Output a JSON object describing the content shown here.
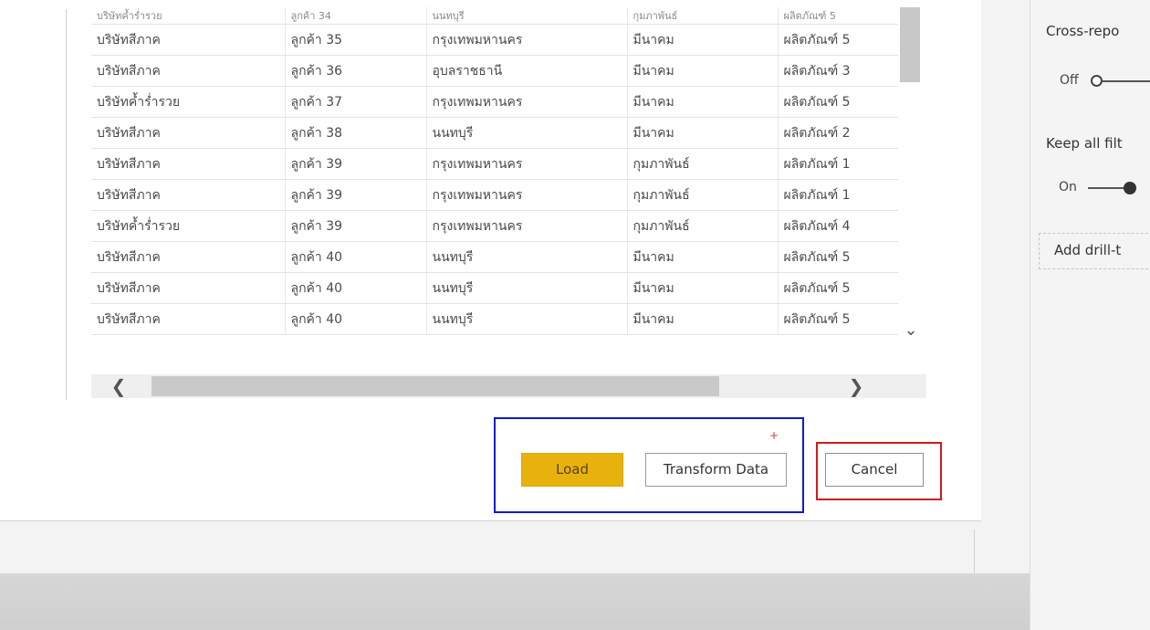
{
  "table": {
    "cut_row": [
      "บริษัทค้ำร่ำรวย",
      "ลูกค้า 34",
      "นนทบุรี",
      "กุมภาพันธ์",
      "ผลิตภัณฑ์ 5"
    ],
    "rows": [
      [
        "บริษัทสีภาค",
        "ลูกค้า 35",
        "กรุงเทพมหานคร",
        "มีนาคม",
        "ผลิตภัณฑ์ 5"
      ],
      [
        "บริษัทสีภาค",
        "ลูกค้า 36",
        "อุบลราชธานี",
        "มีนาคม",
        "ผลิตภัณฑ์ 3"
      ],
      [
        "บริษัทค้ำร่ำรวย",
        "ลูกค้า 37",
        "กรุงเทพมหานคร",
        "มีนาคม",
        "ผลิตภัณฑ์ 5"
      ],
      [
        "บริษัทสีภาค",
        "ลูกค้า 38",
        "นนทบุรี",
        "มีนาคม",
        "ผลิตภัณฑ์ 2"
      ],
      [
        "บริษัทสีภาค",
        "ลูกค้า 39",
        "กรุงเทพมหานคร",
        "กุมภาพันธ์",
        "ผลิตภัณฑ์ 1"
      ],
      [
        "บริษัทสีภาค",
        "ลูกค้า 39",
        "กรุงเทพมหานคร",
        "กุมภาพันธ์",
        "ผลิตภัณฑ์ 1"
      ],
      [
        "บริษัทค้ำร่ำรวย",
        "ลูกค้า 39",
        "กรุงเทพมหานคร",
        "กุมภาพันธ์",
        "ผลิตภัณฑ์ 4"
      ],
      [
        "บริษัทสีภาค",
        "ลูกค้า 40",
        "นนทบุรี",
        "มีนาคม",
        "ผลิตภัณฑ์ 5"
      ],
      [
        "บริษัทสีภาค",
        "ลูกค้า 40",
        "นนทบุรี",
        "มีนาคม",
        "ผลิตภัณฑ์ 5"
      ],
      [
        "บริษัทสีภาค",
        "ลูกค้า 40",
        "นนทบุรี",
        "มีนาคม",
        "ผลิตภัณฑ์ 5"
      ]
    ]
  },
  "scrollbar": {
    "vertical_down_icon": "chevron-down-icon",
    "left_icon": "chevron-left-icon",
    "right_icon": "chevron-right-icon",
    "down_glyph": "⌄",
    "left_glyph": "❮",
    "right_glyph": "❯"
  },
  "buttons": {
    "load_label": "Load",
    "transform_label": "Transform Data",
    "cancel_label": "Cancel",
    "asterisk": "+"
  },
  "right_pane": {
    "cross_report_label": "Cross-repo",
    "cross_report_state": "Off",
    "keep_filters_label": "Keep all filt",
    "keep_filters_state": "On",
    "add_drill_label": "Add drill-t"
  },
  "colors": {
    "load_button": "#e8b20e",
    "highlight_blue": "#0b1dc7",
    "highlight_red": "#d11a1a"
  }
}
